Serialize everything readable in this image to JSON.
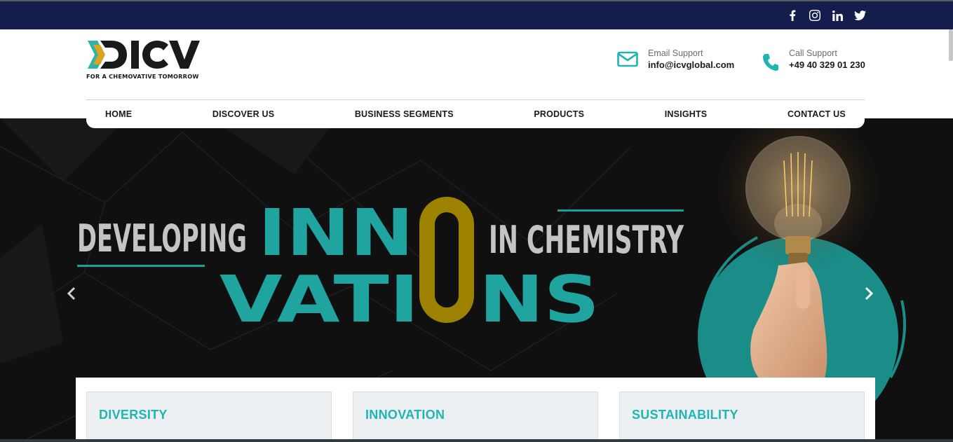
{
  "colors": {
    "topbar": "#141d4c",
    "accent": "#1fb6b1",
    "gold": "#9c8200",
    "hero_bg": "#101010"
  },
  "topbar": {
    "social_icons": [
      "facebook-icon",
      "instagram-icon",
      "linkedin-icon",
      "twitter-icon"
    ]
  },
  "logo": {
    "text": "ICV",
    "tagline": "FOR A CHEMOVATIVE TOMORROW"
  },
  "contact": {
    "email": {
      "label": "Email Support",
      "value": "info@icvglobal.com"
    },
    "phone": {
      "label": "Call Support",
      "value": "+49 40 329 01 230"
    }
  },
  "nav": {
    "items": [
      "HOME",
      "DISCOVER US",
      "BUSINESS SEGMENTS",
      "PRODUCTS",
      "INSIGHTS",
      "CONTACT US"
    ]
  },
  "hero": {
    "line1_left": "DEVELOPING",
    "line1_big": "INN",
    "big_o": "O",
    "line1_right": "IN CHEMISTRY",
    "line2_a": "VATI",
    "line2_b": "NS"
  },
  "cards": [
    {
      "title": "DIVERSITY"
    },
    {
      "title": "INNOVATION"
    },
    {
      "title": "SUSTAINABILITY"
    }
  ]
}
